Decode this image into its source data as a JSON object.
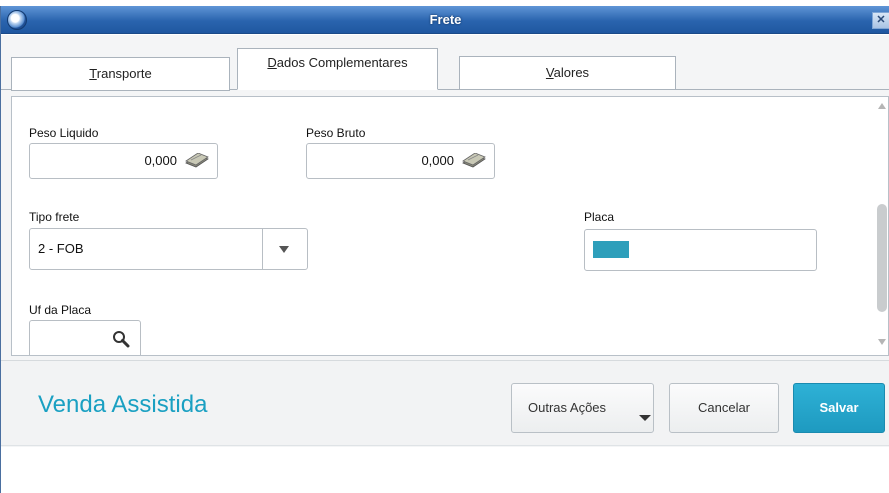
{
  "window": {
    "title": "Frete"
  },
  "tabs": [
    {
      "label": "Transporte",
      "mnemonic": "T",
      "rest": "ransporte",
      "active": false
    },
    {
      "label": "Dados Complementares",
      "mnemonic": "D",
      "rest": "ados Complementares",
      "active": true
    },
    {
      "label": "Valores",
      "mnemonic": "V",
      "rest": "alores",
      "active": false
    }
  ],
  "form": {
    "peso_liquido": {
      "label": "Peso Liquido",
      "value": "0,000"
    },
    "peso_bruto": {
      "label": "Peso Bruto",
      "value": "0,000"
    },
    "tipo_frete": {
      "label": "Tipo frete",
      "value": "2 - FOB"
    },
    "placa": {
      "label": "Placa",
      "value_color": "#2e9fbb"
    },
    "uf_placa": {
      "label": "Uf da Placa",
      "value": ""
    }
  },
  "footer": {
    "brand": "Venda Assistida",
    "other_actions_label": "Outras Ações",
    "cancel_label": "Cancelar",
    "save_label": "Salvar"
  },
  "colors": {
    "accent": "#1aa0c2",
    "titlebar": "#2a64ae",
    "primary_button": "#22a3c8"
  },
  "icons": [
    "app-logo-icon",
    "close-icon",
    "money-icon",
    "chevron-down-icon",
    "search-icon",
    "scroll-up-icon",
    "scroll-down-icon"
  ]
}
